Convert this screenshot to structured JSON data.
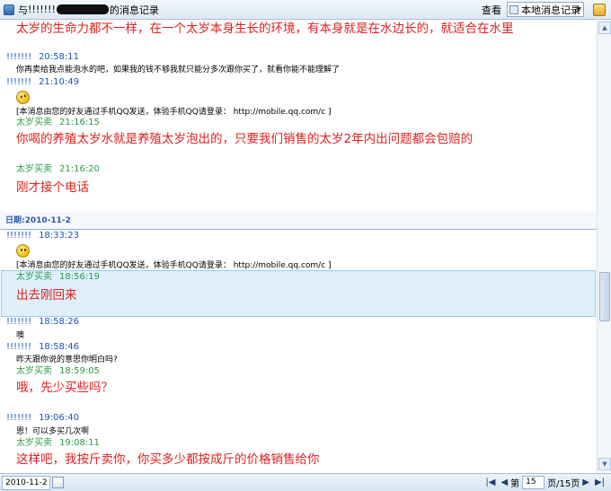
{
  "topbar": {
    "title_prefix": "与",
    "title_name": "!!!!!!!",
    "title_suffix": "的消息记录",
    "view_label": "查看",
    "record_select": "本地消息记录"
  },
  "messages": {
    "m0": {
      "body": "太岁的生命力都不一样，在一个太岁本身生长的环境，有本身就是在水边长的，就适合在水里"
    },
    "m1": {
      "name": "!!!!!!!",
      "time": "20:58:11",
      "body": "你再卖给我点能泡水的吧，如果我的钱不够我就只能分多次跟你买了，就看你能不能理解了"
    },
    "m2": {
      "name": "!!!!!!!",
      "time": "21:10:49",
      "notice": "[本消息由您的好友通过手机QQ发送，体验手机QQ请登录： http://mobile.qq.com/c ]"
    },
    "m3": {
      "name": "太岁买卖",
      "time": "21:16:15",
      "body": "你喝的养殖太岁水就是养殖太岁泡出的，只要我们销售的太岁2年内出问题都会包赔的"
    },
    "m4": {
      "name": "太岁买卖",
      "time": "21:16:20",
      "body": "刚才接个电话"
    },
    "date_label": "日期:2010-11-2",
    "m5": {
      "name": "!!!!!!!",
      "time": "18:33:23",
      "notice": "[本消息由您的好友通过手机QQ发送，体验手机QQ请登录： http://mobile.qq.com/c ]"
    },
    "m6": {
      "name": "太岁买卖",
      "time": "18:56:19",
      "body": "出去刚回来"
    },
    "m7": {
      "name": "!!!!!!!",
      "time": "18:58:26",
      "body": "噢"
    },
    "m8": {
      "name": "!!!!!!!",
      "time": "18:58:46",
      "body": "昨天跟你说的意思你明白吗?"
    },
    "m9": {
      "name": "太岁买卖",
      "time": "18:59:05",
      "body": "哦，先少买些吗？"
    },
    "m10": {
      "name": "!!!!!!!",
      "time": "19:06:40",
      "body": "恩！可以多买几次啊"
    },
    "m11": {
      "name": "太岁买卖",
      "time": "19:08:11",
      "body": "这样吧，我按斤卖你，你买多少都按成斤的价格销售给你"
    }
  },
  "bottombar": {
    "date": "2010-11-2",
    "page_prefix": "第",
    "page_current": "15",
    "page_suffix": "页/15页"
  },
  "colors": {
    "accent": "#1a56b8",
    "self_name": "#2d9a47",
    "message_red": "#e02020",
    "highlight": "#dff0fb"
  }
}
